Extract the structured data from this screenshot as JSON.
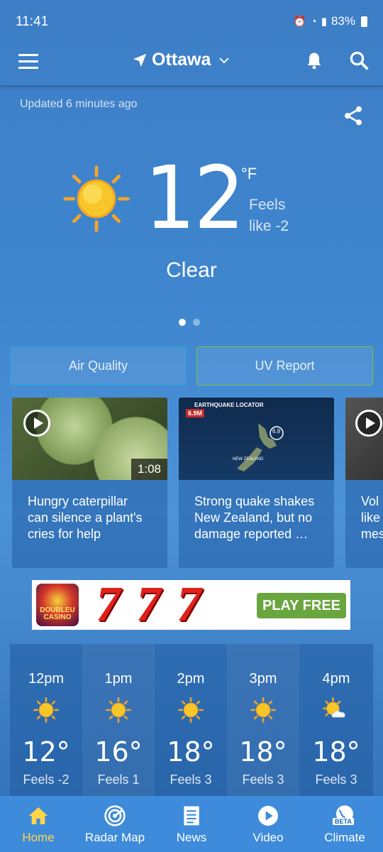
{
  "status": {
    "time": "11:41",
    "battery": "83%"
  },
  "header": {
    "location": "Ottawa",
    "updated": "Updated 6 minutes ago"
  },
  "current": {
    "temp": "12",
    "unit": "°F",
    "feels_like": "Feels like -2",
    "condition": "Clear"
  },
  "carousel": {
    "pages": 2,
    "active": 0
  },
  "buttons": {
    "air_quality": "Air Quality",
    "uv_report": "UV Report"
  },
  "news": [
    {
      "title": "Hungry caterpillar can silence a plant's cries for help",
      "duration": "1:08"
    },
    {
      "title": "Strong quake shakes New Zealand, but no damage reported …",
      "thumb_label": "EARTHQUAKE LOCATOR",
      "magnitude": "6.9",
      "region": "NEW ZEALAND"
    },
    {
      "title": "Vol like mes"
    }
  ],
  "ad": {
    "brand": "DOUBLEU CASINO",
    "slots": "777",
    "cta": "PLAY FREE"
  },
  "hourly": [
    {
      "time": "12pm",
      "temp": "12°",
      "feels": "Feels -2",
      "icon": "sun-icon"
    },
    {
      "time": "1pm",
      "temp": "16°",
      "feels": "Feels 1",
      "icon": "sun-icon"
    },
    {
      "time": "2pm",
      "temp": "18°",
      "feels": "Feels 3",
      "icon": "sun-icon"
    },
    {
      "time": "3pm",
      "temp": "18°",
      "feels": "Feels 3",
      "icon": "sun-icon"
    },
    {
      "time": "4pm",
      "temp": "18°",
      "feels": "Feels 3",
      "icon": "sun-cloud-icon"
    }
  ],
  "nav": [
    {
      "label": "Home",
      "active": true
    },
    {
      "label": "Radar Map"
    },
    {
      "label": "News"
    },
    {
      "label": "Video"
    },
    {
      "label": "Climate",
      "badge": "BETA"
    }
  ],
  "colors": {
    "nav_active": "#ffd54a",
    "air_quality_border": "#1fa4d8",
    "uv_border": "#7cc442"
  }
}
